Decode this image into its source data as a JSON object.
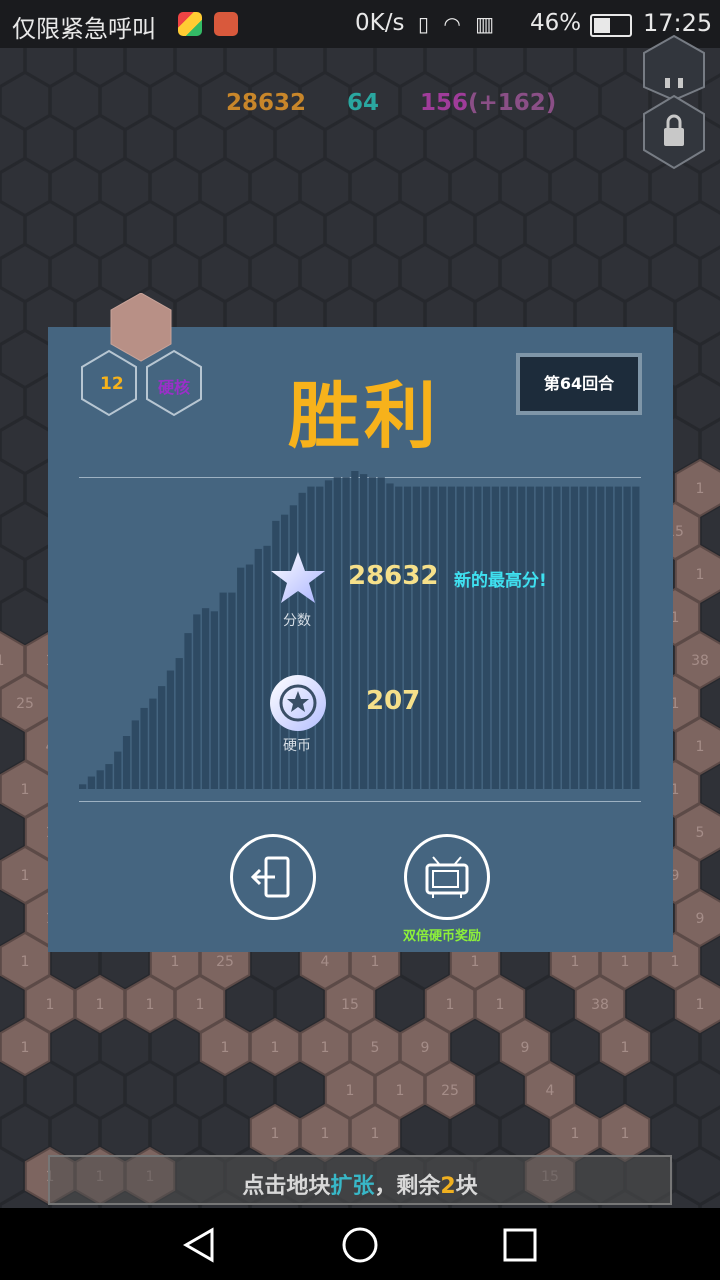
{
  "status_bar": {
    "carrier_text": "仅限紧急呼叫",
    "net_speed": "0K/s",
    "battery_pct": "46%",
    "time": "17:25"
  },
  "hud": {
    "score": "28632",
    "round": "64",
    "coins": "156",
    "coins_delta": "(+162)",
    "colors": {
      "score": "#c8862a",
      "round": "#2aa7a0",
      "coins": "#a03c9a"
    }
  },
  "dialog": {
    "level": "12",
    "difficulty": "硬核",
    "title": "胜利",
    "round_label": "第64回合",
    "score_label": "分数",
    "score_value": "28632",
    "new_highscore": "新的最高分!",
    "coin_label": "硬币",
    "coin_value": "207",
    "double_coin_label": "双倍硬币奖励"
  },
  "bottom_hint": {
    "prefix": "点击地块",
    "action": "扩张",
    "middle": "，剩余",
    "count": "2",
    "suffix": "块"
  },
  "board_tiles": [
    "1",
    "1",
    "1",
    "25",
    "4",
    "1",
    "1",
    "1",
    "1",
    "1",
    "1",
    "1",
    "1",
    "15",
    "1",
    "1",
    "38",
    "1",
    "1",
    "1",
    "5",
    "9",
    "9"
  ],
  "chart_data": {
    "type": "bar",
    "title": "",
    "xlabel": "",
    "ylabel": "",
    "x": [
      1,
      2,
      3,
      4,
      5,
      6,
      7,
      8,
      9,
      10,
      11,
      12,
      13,
      14,
      15,
      16,
      17,
      18,
      19,
      20,
      21,
      22,
      23,
      24,
      25,
      26,
      27,
      28,
      29,
      30,
      31,
      32,
      33,
      34,
      35,
      36,
      37,
      38,
      39,
      40,
      41,
      42,
      43,
      44,
      45,
      46,
      47,
      48,
      49,
      50,
      51,
      52,
      53,
      54,
      55,
      56,
      57,
      58,
      59,
      60,
      61,
      62,
      63,
      64
    ],
    "values": [
      1.5,
      4,
      6,
      8,
      12,
      17,
      22,
      26,
      29,
      33,
      38,
      42,
      50,
      56,
      58,
      57,
      63,
      63,
      71,
      72,
      77,
      78,
      86,
      88,
      91,
      95,
      97,
      97,
      99,
      100,
      100,
      102,
      101,
      100,
      100,
      98,
      97,
      97,
      97,
      97,
      97,
      97,
      97,
      97,
      97,
      97,
      97,
      97,
      97,
      97,
      97,
      97,
      97,
      97,
      97,
      97,
      97,
      97,
      97,
      97,
      97,
      97,
      97,
      97
    ],
    "ylim": [
      0,
      100
    ],
    "grid": false
  }
}
